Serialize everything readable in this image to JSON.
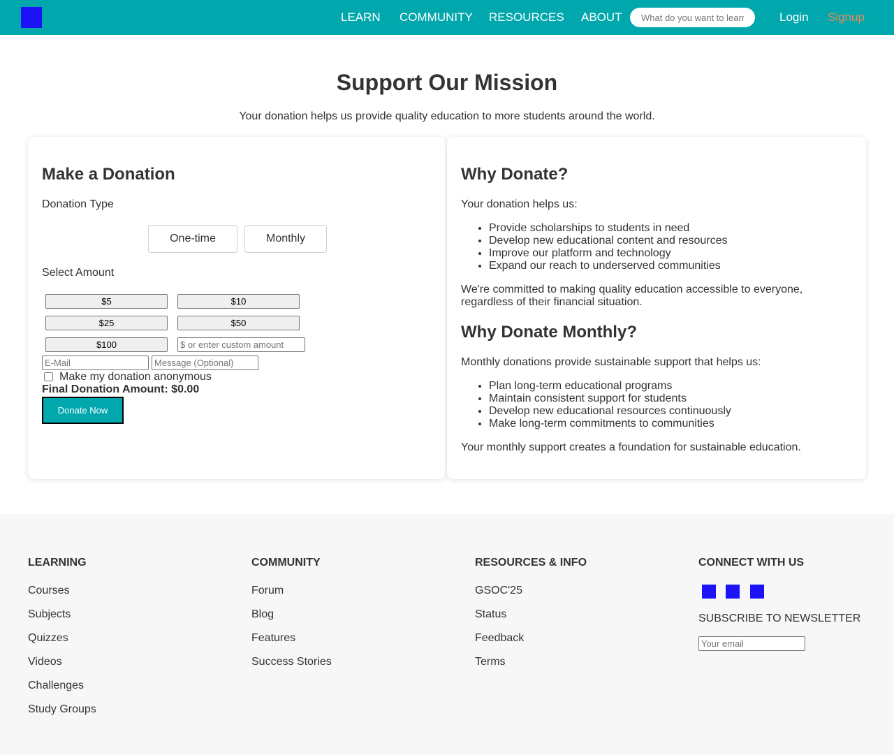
{
  "nav": {
    "logo_icon": "logo-square",
    "links": [
      "LEARN",
      "COMMUNITY",
      "RESOURCES",
      "ABOUT"
    ],
    "search_placeholder": "What do you want to learn?",
    "login": "Login",
    "signup": "Signup"
  },
  "hero": {
    "title": "Support Our Mission",
    "subtitle": "Your donation helps us provide quality education to more students around the world."
  },
  "donation": {
    "heading": "Make a Donation",
    "type_label": "Donation Type",
    "types": [
      "One-time",
      "Monthly"
    ],
    "amount_label": "Select Amount",
    "amounts": [
      "$5",
      "$10",
      "$25",
      "$50",
      "$100"
    ],
    "custom_placeholder": "$ or enter custom amount",
    "email_placeholder": "E-Mail",
    "message_placeholder": "Message (Optional)",
    "anonymous_label": "Make my donation anonymous",
    "anonymous_checked": false,
    "final_label": "Final Donation Amount:",
    "final_value": "$0.00",
    "donate_button": "Donate Now"
  },
  "why": {
    "heading": "Why Donate?",
    "intro": "Your donation helps us:",
    "items": [
      "Provide scholarships to students in need",
      "Develop new educational content and resources",
      "Improve our platform and technology",
      "Expand our reach to underserved communities"
    ],
    "commitment": "We're committed to making quality education accessible to everyone, regardless of their financial situation.",
    "monthly_heading": "Why Donate Monthly?",
    "monthly_intro": "Monthly donations provide sustainable support that helps us:",
    "monthly_items": [
      "Plan long-term educational programs",
      "Maintain consistent support for students",
      "Develop new educational resources continuously",
      "Make long-term commitments to communities"
    ],
    "monthly_outro": "Your monthly support creates a foundation for sustainable education."
  },
  "footer": {
    "learning": {
      "heading": "LEARNING",
      "links": [
        "Courses",
        "Subjects",
        "Quizzes",
        "Videos",
        "Challenges",
        "Study Groups"
      ]
    },
    "community": {
      "heading": "COMMUNITY",
      "links": [
        "Forum",
        "Blog",
        "Features",
        "Success Stories"
      ]
    },
    "resources": {
      "heading": "RESOURCES & INFO",
      "links": [
        "GSOC'25",
        "Status",
        "Feedback",
        "Terms"
      ]
    },
    "connect": {
      "heading": "CONNECT WITH US",
      "social_icons": [
        "social-icon-1",
        "social-icon-2",
        "social-icon-3"
      ],
      "newsletter_label": "SUBSCRIBE TO NEWSLETTER",
      "email_placeholder": "Your email"
    }
  },
  "colors": {
    "brand": "#00a7ad",
    "signup": "#ef8a55",
    "icon_placeholder": "#1b12f7",
    "footer_bg": "#f7f7f7"
  }
}
